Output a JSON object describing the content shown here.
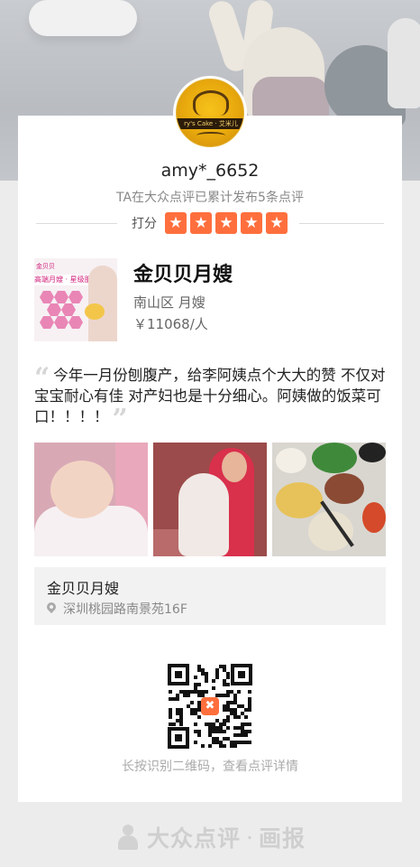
{
  "header": {
    "avatar_text": "ry's Cake · 艾米儿"
  },
  "profile": {
    "username": "amy*_6652",
    "summary": "TA在大众点评已累计发布5条点评",
    "rating_label": "打分",
    "stars": 5
  },
  "shop": {
    "name": "金贝贝月嫂",
    "area": "南山区 月嫂",
    "price": "￥11068/人",
    "thumb_tag": "金贝贝",
    "thumb_title": "高端月嫂 · 星级服务"
  },
  "review": {
    "text": "今年一月份刨腹产，给李阿姨点个大大的赞 不仅对宝宝耐心有佳 对产妇也是十分细心。阿姨做的饭菜可口！！！！",
    "open_quote": "“",
    "close_quote": "”"
  },
  "photos": [
    {
      "subject": "newborn baby in blanket"
    },
    {
      "subject": "woman holding baby"
    },
    {
      "subject": "dishes on a table"
    }
  ],
  "location": {
    "name": "金贝贝月嫂",
    "address": "深圳桃园路南景苑16F"
  },
  "qr": {
    "hint": "长按识别二维码，查看点评详情",
    "logo": "✖"
  },
  "brand": {
    "name": "大众点评",
    "separator": "·",
    "sub": "画报"
  },
  "colors": {
    "accent": "#ff6f3d",
    "card": "#ffffff",
    "page": "#ececec"
  }
}
